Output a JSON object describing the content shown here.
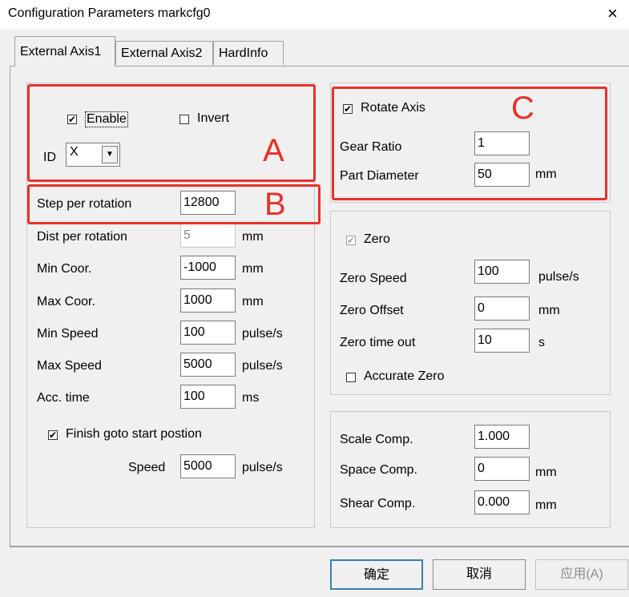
{
  "window": {
    "title": "Configuration Parameters markcfg0",
    "close_glyph": "×"
  },
  "tabs": [
    "External Axis1",
    "External Axis2",
    "HardInfo"
  ],
  "axis_group": {
    "enable_label": "Enable",
    "enable_checked": true,
    "invert_label": "Invert",
    "invert_checked": false,
    "id_label": "ID",
    "id_value": "X"
  },
  "params": {
    "step_label": "Step per rotation",
    "step_value": "12800",
    "dist_label": "Dist per rotation",
    "dist_value": "5",
    "dist_unit": "mm",
    "min_coor_label": "Min Coor.",
    "min_coor_value": "-1000",
    "min_coor_unit": "mm",
    "max_coor_label": "Max Coor.",
    "max_coor_value": "1000",
    "max_coor_unit": "mm",
    "min_speed_label": "Min Speed",
    "min_speed_value": "100",
    "min_speed_unit": "pulse/s",
    "max_speed_label": "Max Speed",
    "max_speed_value": "5000",
    "max_speed_unit": "pulse/s",
    "acc_label": "Acc. time",
    "acc_value": "100",
    "acc_unit": "ms",
    "finish_label": "Finish goto start postion",
    "finish_checked": true,
    "speed_label": "Speed",
    "speed_value": "5000",
    "speed_unit": "pulse/s"
  },
  "rotate": {
    "rotate_label": "Rotate Axis",
    "rotate_checked": true,
    "gear_label": "Gear Ratio",
    "gear_value": "1",
    "part_label": "Part Diameter",
    "part_value": "50",
    "part_unit": "mm"
  },
  "zero": {
    "zero_label": "Zero",
    "zero_checked": true,
    "speed_label": "Zero Speed",
    "speed_value": "100",
    "speed_unit": "pulse/s",
    "offset_label": "Zero Offset",
    "offset_value": "0",
    "offset_unit": "mm",
    "timeout_label": "Zero time out",
    "timeout_value": "10",
    "timeout_unit": "s",
    "accurate_label": "Accurate Zero",
    "accurate_checked": false
  },
  "comp": {
    "scale_label": "Scale Comp.",
    "scale_value": "1.000",
    "space_label": "Space Comp.",
    "space_value": "0",
    "space_unit": "mm",
    "shear_label": "Shear Comp.",
    "shear_value": "0.000",
    "shear_unit": "mm"
  },
  "annotations": {
    "a": "A",
    "b": "B",
    "c": "C",
    "color": "#e8302a"
  },
  "buttons": {
    "ok": "确定",
    "cancel": "取消",
    "apply": "应用(A)"
  },
  "icons": {
    "check": "✔",
    "dropdown": "▼"
  }
}
